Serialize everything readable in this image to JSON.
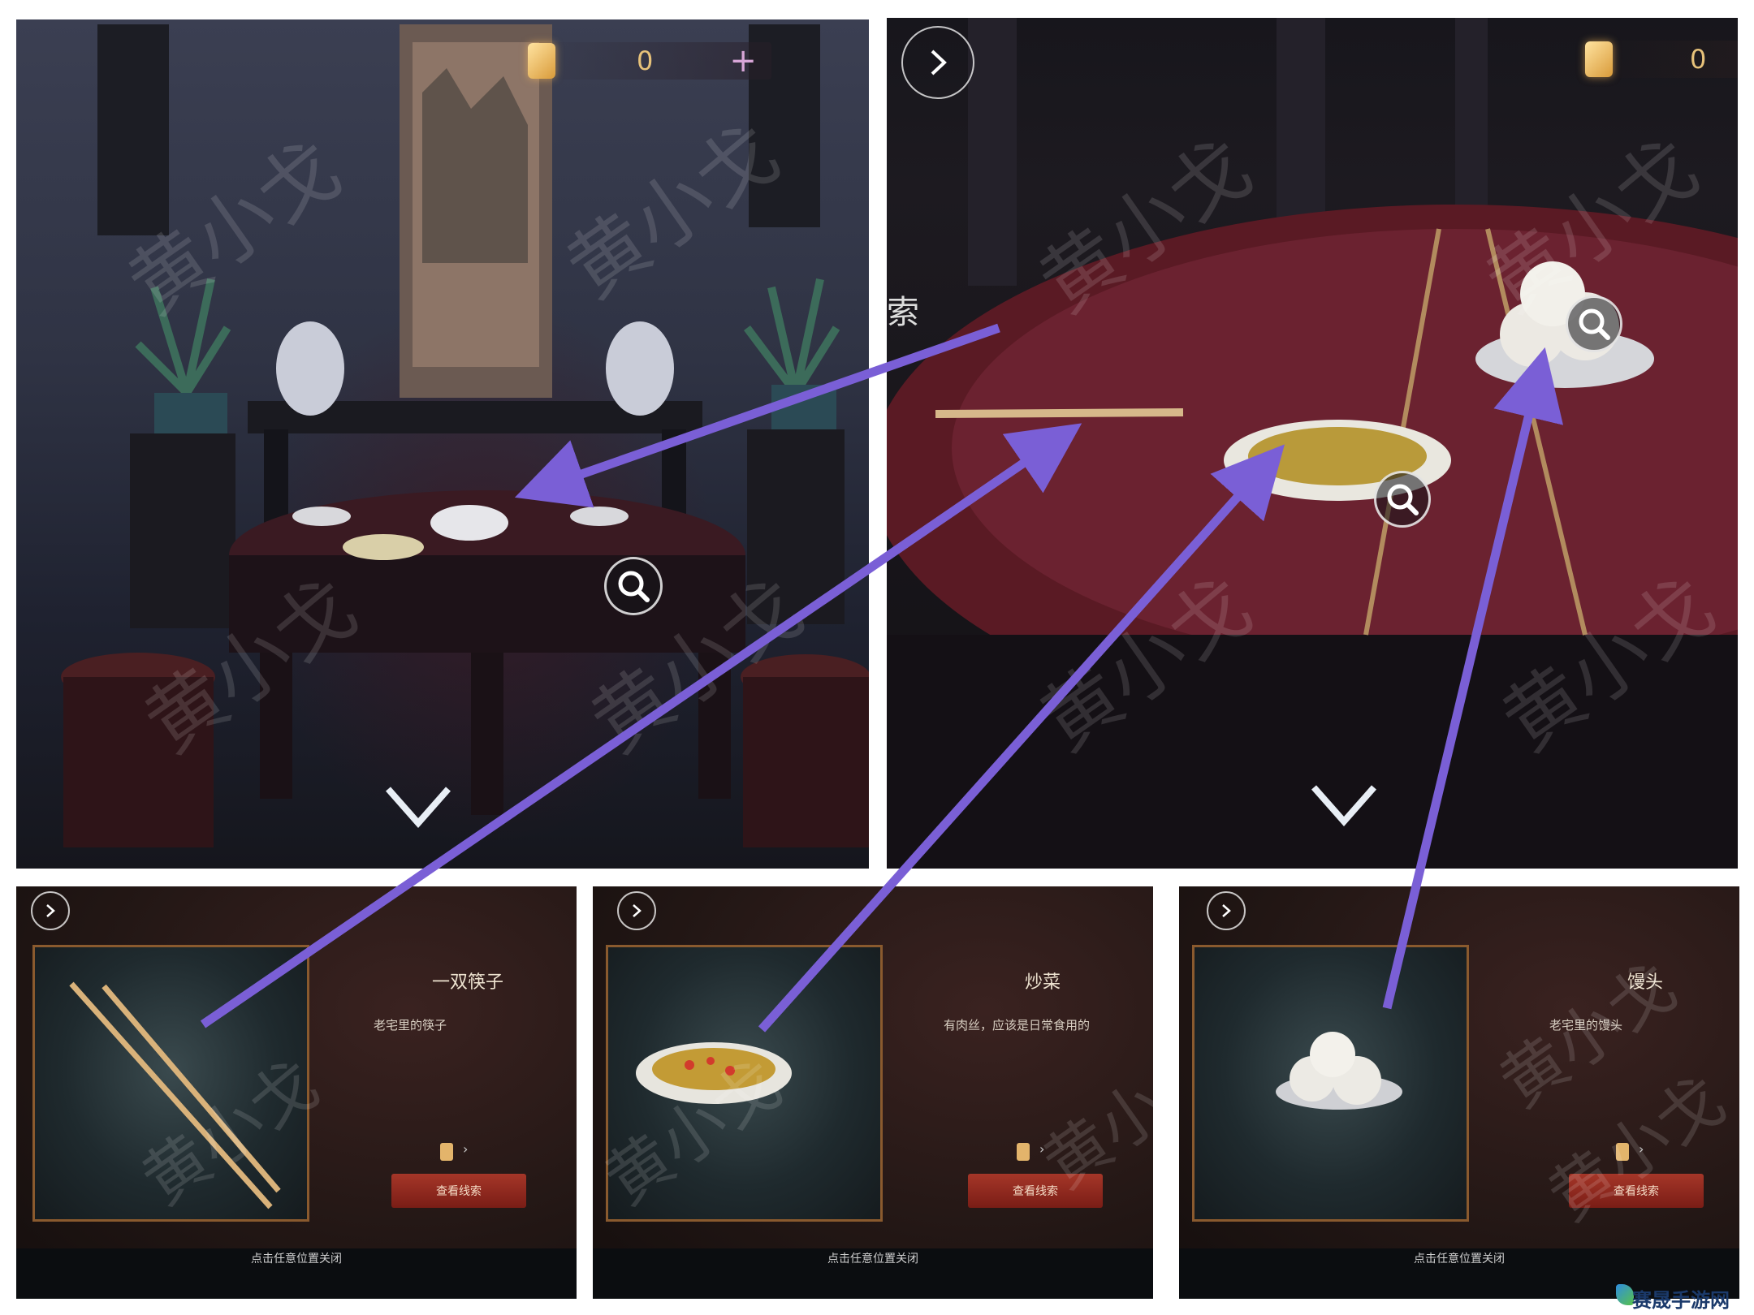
{
  "scene1": {
    "currency_value": "0",
    "plus_label": "+",
    "inspect_icon": "magnifier-icon",
    "nav_down_icon": "chevron-down-icon"
  },
  "scene2": {
    "currency_value": "0",
    "next_icon": "chevron-right-icon",
    "nav_down_icon": "chevron-down-icon",
    "side_char": "索"
  },
  "items": [
    {
      "title": "一双筷子",
      "desc": "老宅里的筷子",
      "action": "查看线索",
      "hint": "点击任意位置关闭"
    },
    {
      "title": "炒菜",
      "desc": "有肉丝，应该是日常食用的",
      "action": "查看线索",
      "hint": "点击任意位置关闭"
    },
    {
      "title": "馒头",
      "desc": "老宅里的馒头",
      "action": "查看线索",
      "hint": "点击任意位置关闭"
    }
  ],
  "watermark": "黄小戈",
  "brand": {
    "name": "赛晟手游网"
  },
  "colors": {
    "arrow": "#7a5fd6",
    "accent_red": "#9b2f24",
    "frame_gold": "#8a5a2e"
  }
}
